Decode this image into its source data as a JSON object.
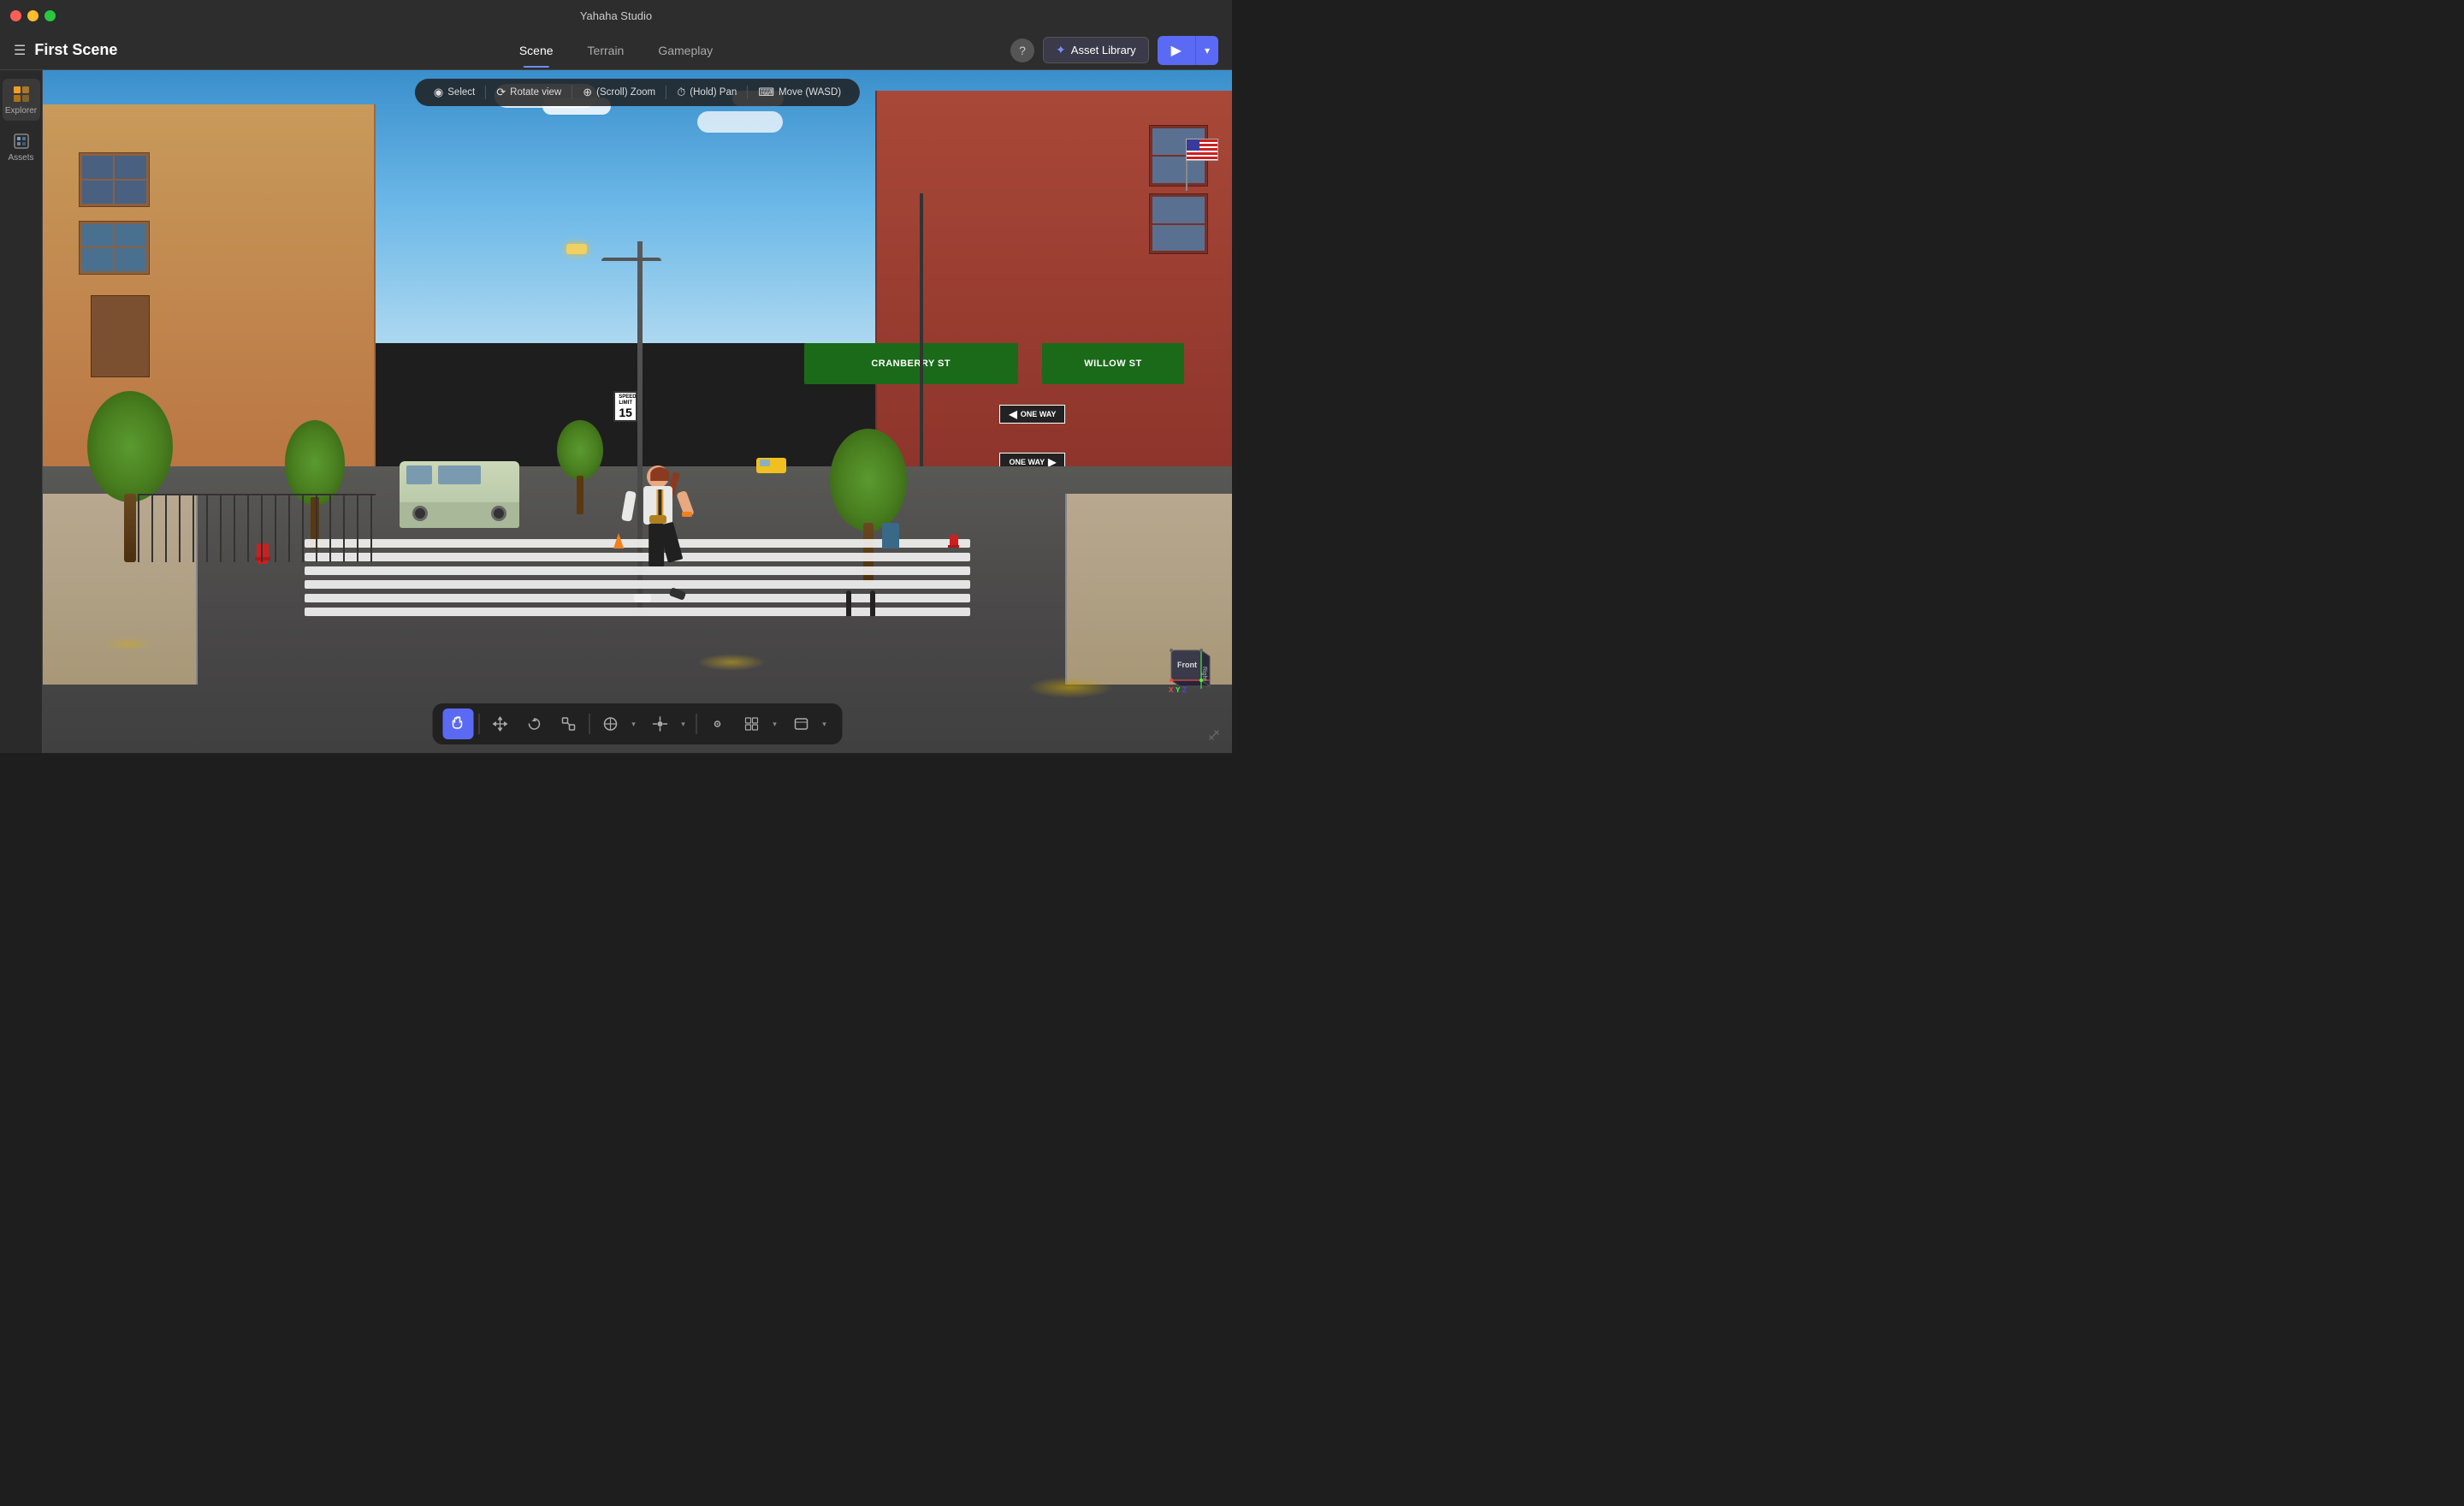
{
  "window": {
    "title": "Yahaha Studio"
  },
  "titlebar": {
    "title": "Yahaha Studio",
    "traffic_lights": [
      "red",
      "yellow",
      "green"
    ]
  },
  "toolbar": {
    "menu_icon": "☰",
    "scene_title": "First Scene",
    "tabs": [
      {
        "label": "Scene",
        "active": true
      },
      {
        "label": "Terrain",
        "active": false
      },
      {
        "label": "Gameplay",
        "active": false
      }
    ],
    "help_icon": "?",
    "asset_library_label": "Asset Library",
    "asset_library_icon": "✦",
    "play_icon": "▶",
    "dropdown_icon": "▾"
  },
  "sidebar": {
    "items": [
      {
        "label": "Explorer",
        "icon": "explorer"
      },
      {
        "label": "Assets",
        "icon": "assets"
      }
    ]
  },
  "viewport": {
    "tools": [
      {
        "label": "Select",
        "icon": "◎"
      },
      {
        "label": "Rotate view",
        "icon": "○"
      },
      {
        "label": "(Scroll) Zoom",
        "icon": "⊕"
      },
      {
        "label": "(Hold) Pan",
        "icon": "⌚"
      },
      {
        "label": "Move (WASD)",
        "icon": "⌨"
      }
    ]
  },
  "scene": {
    "street_signs": {
      "cranberry": "CRANBERRY ST",
      "willow": "WILLOW ST",
      "one_way": "ONE WAY",
      "one_way_2": "ONE WAY",
      "speed_limit_label": "SPEED LIMIT",
      "speed_limit_value": "15"
    }
  },
  "bottom_toolbar": {
    "tools": [
      {
        "icon": "✋",
        "active": true,
        "name": "hand"
      },
      {
        "icon": "✛",
        "active": false,
        "name": "move"
      },
      {
        "icon": "↻",
        "active": false,
        "name": "rotate"
      },
      {
        "icon": "⊡",
        "active": false,
        "name": "scale"
      },
      {
        "icon": "⊕",
        "active": false,
        "name": "transform"
      },
      {
        "icon": "❖",
        "active": false,
        "name": "gizmo"
      },
      {
        "icon": "⊙",
        "active": false,
        "name": "pivot"
      },
      {
        "icon": "▦",
        "active": false,
        "name": "grid"
      },
      {
        "icon": "⬜",
        "active": false,
        "name": "frame"
      }
    ]
  },
  "orientation_cube": {
    "front_label": "Front",
    "right_label": "Right"
  },
  "colors": {
    "accent": "#5b6af5",
    "active_tab_underline": "#6c8ef5",
    "toolbar_bg": "#2d2d2d",
    "sidebar_bg": "#2a2a2a",
    "one_way_bg": "#222222",
    "cranberry_sign_bg": "#228B22"
  }
}
